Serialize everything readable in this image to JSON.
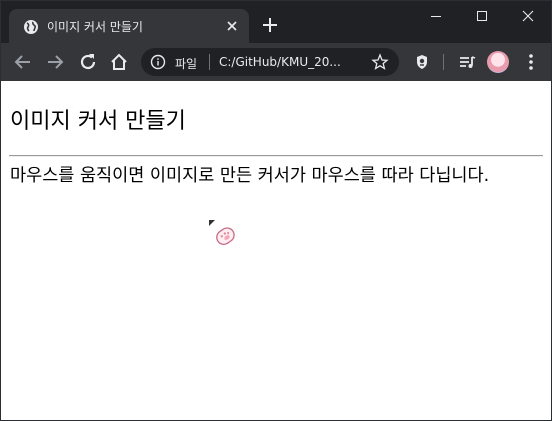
{
  "browser": {
    "tab": {
      "title": "이미지 커서 만들기",
      "favicon_icon": "globe-icon"
    },
    "window_controls": [
      "minimize-icon",
      "maximize-icon",
      "close-icon"
    ],
    "toolbar": {
      "address_scheme": "파일",
      "address_url": "C:/GitHub/KMU_20...",
      "icons": [
        "back-icon",
        "forward-icon",
        "reload-icon",
        "home-icon",
        "info-icon",
        "star-icon",
        "extension-icon",
        "media-playlist-icon",
        "profile-avatar",
        "more-menu-icon"
      ]
    },
    "colors": {
      "frame": "#202124",
      "toolbar": "#35363a",
      "omnibox": "#202124",
      "text": "#e8eaed"
    }
  },
  "page": {
    "title": "이미지 커서 만들기",
    "description": "마우스를 움직이면 이미지로 만든 커서가 마우스를 따라 다닙니다.",
    "cursor_icon": "cat-paw-cursor-icon"
  }
}
